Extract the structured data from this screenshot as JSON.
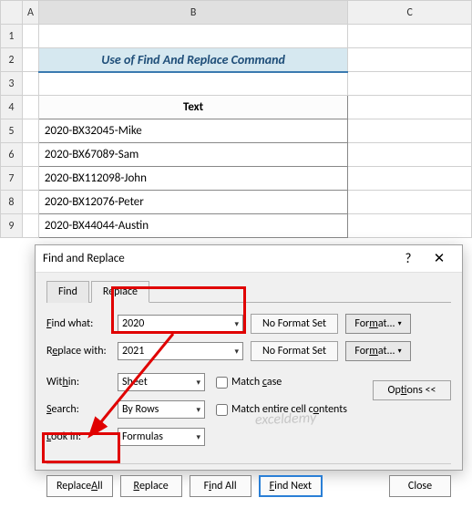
{
  "columns": {
    "a": "A",
    "b": "B",
    "c": "C"
  },
  "rows": [
    "1",
    "2",
    "3",
    "4",
    "5",
    "6",
    "7",
    "8",
    "9"
  ],
  "title": "Use of Find And Replace Command",
  "table": {
    "header": "Text",
    "cells": [
      "2020-BX32045-Mike",
      "2020-BX67089-Sam",
      "2020-BX112098-John",
      "2020-BX12076-Peter",
      "2020-BX44044-Austin"
    ]
  },
  "dialog": {
    "title": "Find and Replace",
    "help": "?",
    "close": "✕",
    "tabs": {
      "find": "Find",
      "replace": "Replace"
    },
    "find_label": "Find what:",
    "find_value": "2020",
    "replace_label": "Replace with:",
    "replace_value": "2021",
    "no_format": "No Format Set",
    "format": "Format...",
    "within_label": "Within:",
    "within_value": "Sheet",
    "search_label": "Search:",
    "search_value": "By Rows",
    "lookin_label": "Look in:",
    "lookin_value": "Formulas",
    "match_case": "Match case",
    "match_contents": "Match entire cell contents",
    "options": "Options <<",
    "replace_all": "Replace All",
    "replace_btn": "Replace",
    "find_all": "Find All",
    "find_next": "Find Next",
    "close_btn": "Close"
  },
  "watermark": "exceldemy"
}
